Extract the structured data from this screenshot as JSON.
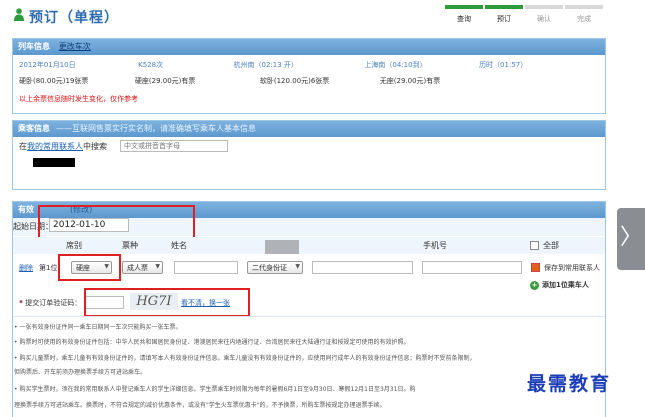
{
  "header": {
    "title": "预订（单程）",
    "steps": [
      {
        "label": "查询",
        "done": true
      },
      {
        "label": "预订",
        "done": true
      },
      {
        "label": "确认",
        "done": false
      },
      {
        "label": "完成",
        "done": false
      }
    ]
  },
  "train": {
    "section_title": "列车信息",
    "change_link": "更改车次",
    "date": "2012年01月10日",
    "train_no": "K528次",
    "from": "杭州南（02:13 开）",
    "to": "上海南（04:10到）",
    "duration": "历时（01:57）",
    "seats": [
      "硬卧(80.00元)19张票",
      "硬座(29.00元)有票",
      "软卧(120.00元)6张票",
      "无座(29.00元)有票"
    ],
    "warning": "以上余票信息随时发生变化，仅作参考"
  },
  "passenger": {
    "section_title": "乘客信息",
    "section_desc": "——互联网售票实行实名制，请准确填写乘车人基本信息",
    "search_prefix": "在",
    "search_link": "我的常用联系人",
    "search_suffix": "中搜索",
    "search_placeholder": "中文或拼音首字母"
  },
  "ticket": {
    "section_title": "有效",
    "section_title_hidden": "(修改)",
    "date_label": "起始日期：",
    "date_value": "2012-01-10",
    "columns": {
      "seat": "席别",
      "ticket_type": "票种",
      "name": "姓名",
      "phone": "手机号",
      "select_all": "全部"
    },
    "row": {
      "delete": "删除",
      "index": "第1位",
      "seat": "硬座",
      "ticket_type": "成人票",
      "id_type": "二代身份证",
      "save_contact": "保存到常用联系人"
    },
    "add_passenger": "添加1位乘车人",
    "captcha_label": "* 提交订单验证码：",
    "captcha_text": "HG7I",
    "captcha_refresh": "看不清，换一张"
  },
  "notes": [
    "• 一张有效身份证件同一乘车日期同一车次只能购买一张车票。",
    "• 购票时可使用的有效身份证件包括：中华人民共和国居民身份证、港澳居民来往内地通行证、台湾居民来往大陆通行证和按规定可使用的有效护照。",
    "• 购买儿童票时，乘车儿童有有效身份证件的，请填写本人有效身份证件信息。乘车儿童没有有效身份证件的，应使用同行成年人的有效身份证件信息；购票时不受前条限制，",
    "  但购票后、开车前须办理换票手续方可进站乘车。",
    "• 购买学生票时，须在我的常用联系人中登记乘车人的学生详细信息。学生票乘车时间限为每年的暑假6月1日至9月30日、寒假12月1日至3月31日。购",
    "  理换票手续方可进站乘车。换票时，不符合规定的减价优惠条件，或没有\"学生火车票优惠卡\"的，不予换票，所购车票按规定办理退票手续。"
  ],
  "watermark": "最需教育"
}
